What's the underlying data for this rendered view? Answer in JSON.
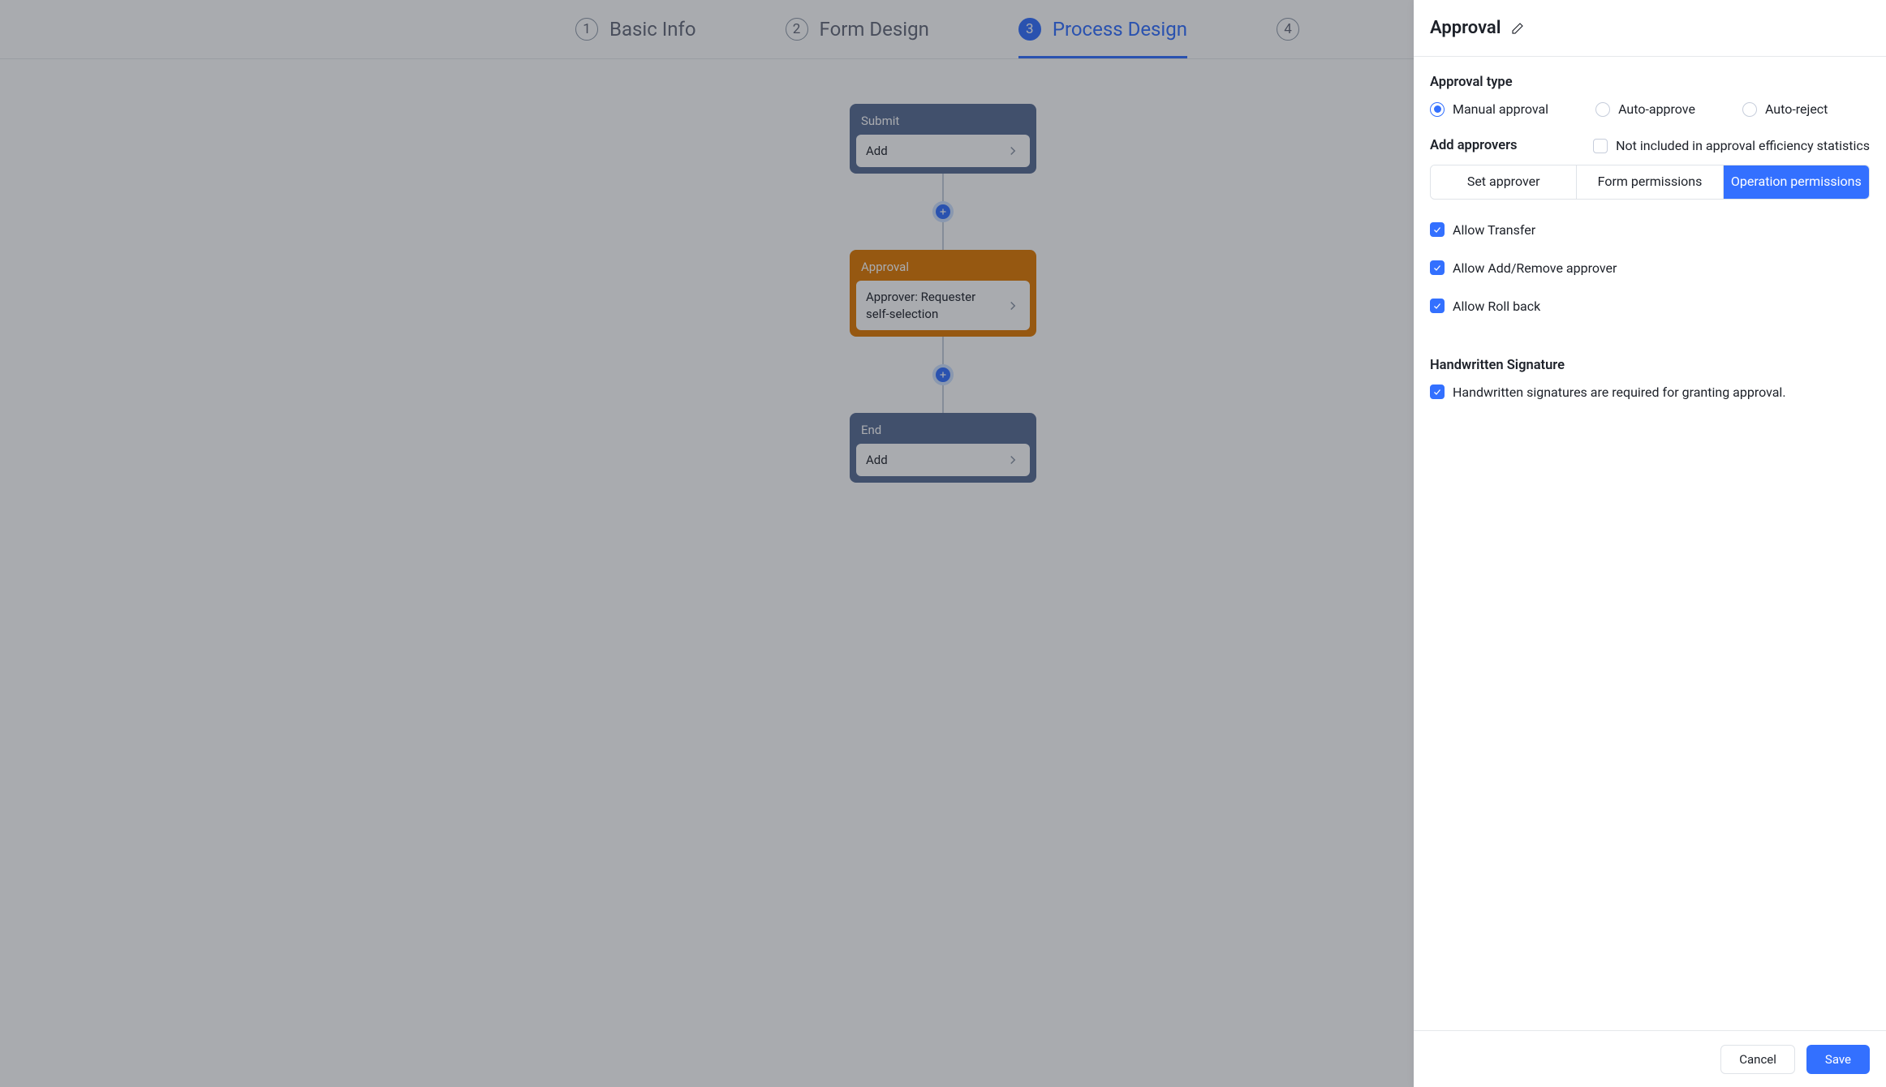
{
  "steps": [
    {
      "num": "1",
      "label": "Basic Info",
      "active": false
    },
    {
      "num": "2",
      "label": "Form Design",
      "active": false
    },
    {
      "num": "3",
      "label": "Process Design",
      "active": true
    },
    {
      "num": "4",
      "label": "",
      "active": false
    }
  ],
  "flow": {
    "submit": {
      "title": "Submit",
      "body": "Add"
    },
    "approval": {
      "title": "Approval",
      "body": "Approver: Requester self-selection"
    },
    "end": {
      "title": "End",
      "body": "Add"
    }
  },
  "panel": {
    "title": "Approval",
    "approval_type_heading": "Approval type",
    "radios": {
      "manual": "Manual approval",
      "auto_approve": "Auto-approve",
      "auto_reject": "Auto-reject"
    },
    "add_approvers_heading": "Add approvers",
    "efficiency_checkbox": "Not included in approval efficiency statistics",
    "segtabs": {
      "set_approver": "Set approver",
      "form_permissions": "Form permissions",
      "operation_permissions": "Operation permissions"
    },
    "permissions": {
      "transfer": "Allow Transfer",
      "add_remove": "Allow Add/Remove approver",
      "rollback": "Allow Roll back"
    },
    "signature_heading": "Handwritten Signature",
    "signature_checkbox": "Handwritten signatures are required for granting approval.",
    "buttons": {
      "cancel": "Cancel",
      "save": "Save"
    }
  }
}
